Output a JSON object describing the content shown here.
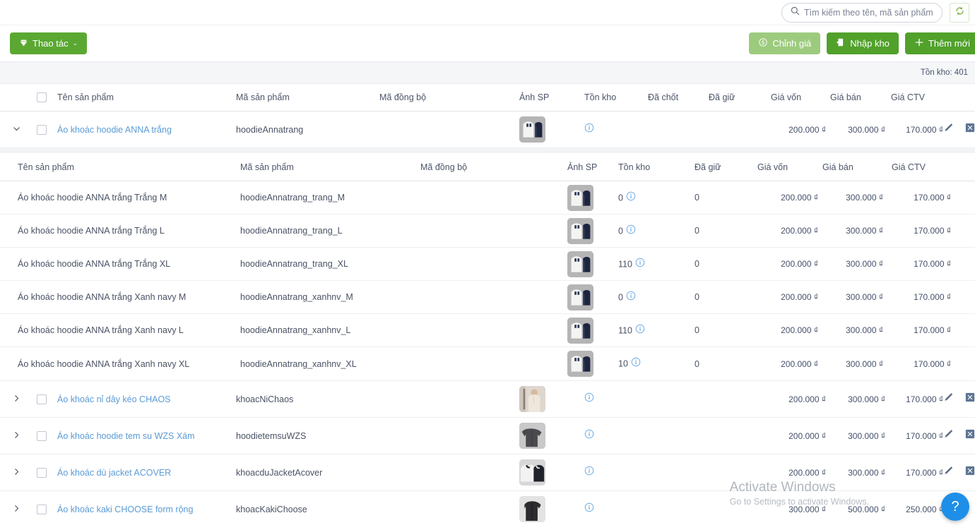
{
  "search": {
    "placeholder": "Tìm kiếm theo tên, mã sản phẩm",
    "value": "",
    "icon": "search-icon"
  },
  "refresh": {
    "icon": "refresh-icon",
    "label": ""
  },
  "toolbar": {
    "action_label": "Thao tác",
    "action_icon": "diamond-icon",
    "action_caret": "⌄",
    "adjust_price_label": "Chỉnh giá",
    "adjust_price_icon": "sync-price-icon",
    "import_stock_label": "Nhập kho",
    "import_stock_icon": "import-icon",
    "add_new_label": "Thêm mới",
    "add_new_icon": "plus-icon"
  },
  "summary": {
    "stock_total_label": "Tồn kho: 401"
  },
  "table": {
    "headers": {
      "name": "Tên sản phẩm",
      "code": "Mã sản phẩm",
      "sync": "Mã đồng bộ",
      "image": "Ảnh SP",
      "stock": "Tồn kho",
      "locked": "Đã chốt",
      "held": "Đã giữ",
      "cost": "Giá vốn",
      "sell": "Giá bán",
      "ctv": "Giá CTV"
    },
    "rows": [
      {
        "expanded": true,
        "expand_icon": "chevron-down-icon",
        "name": "Áo khoác hoodie ANNA trắng",
        "code": "hoodieAnnatrang",
        "sync": "",
        "thumb": "hoodie-white-navy",
        "stock": "",
        "locked": "",
        "held": "",
        "cost": "200.000 ₫",
        "sell": "300.000 ₫",
        "ctv": "170.000 ₫"
      },
      {
        "expanded": false,
        "expand_icon": "chevron-right-icon",
        "name": "Áo khoác nỉ dây kéo CHAOS",
        "code": "khoacNiChaos",
        "sync": "",
        "thumb": "model-beige",
        "stock": "",
        "locked": "",
        "held": "",
        "cost": "200.000 ₫",
        "sell": "300.000 ₫",
        "ctv": "170.000 ₫"
      },
      {
        "expanded": false,
        "expand_icon": "chevron-right-icon",
        "name": "Áo khoác hoodie tem su WZS Xám",
        "code": "hoodietemsuWZS",
        "sync": "",
        "thumb": "hoodie-grey",
        "stock": "",
        "locked": "",
        "held": "",
        "cost": "200.000 ₫",
        "sell": "300.000 ₫",
        "ctv": "170.000 ₫"
      },
      {
        "expanded": false,
        "expand_icon": "chevron-right-icon",
        "name": "Áo khoác dù jacket ACOVER",
        "code": "khoacduJacketAcover",
        "sync": "",
        "thumb": "jacket-black-white",
        "stock": "",
        "locked": "",
        "held": "",
        "cost": "200.000 ₫",
        "sell": "300.000 ₫",
        "ctv": "170.000 ₫"
      },
      {
        "expanded": false,
        "expand_icon": "chevron-right-icon",
        "name": "Áo khoác kaki CHOOSE form rộng",
        "code": "khoacKakiChoose",
        "sync": "",
        "thumb": "kaki-dark",
        "stock": "",
        "locked": "",
        "held": "",
        "cost": "300.000 ₫",
        "sell": "500.000 ₫",
        "ctv": "250.000 ₫"
      }
    ]
  },
  "subtable": {
    "headers": {
      "name": "Tên sản phẩm",
      "code": "Mã sản phẩm",
      "sync": "Mã đồng bộ",
      "image": "Ảnh SP",
      "stock": "Tồn kho",
      "held": "Đã giữ",
      "cost": "Giá vốn",
      "sell": "Giá bán",
      "ctv": "Giá CTV"
    },
    "rows": [
      {
        "name": "Áo khoác hoodie ANNA trắng Trắng M",
        "code": "hoodieAnnatrang_trang_M",
        "sync": "",
        "thumb": "hoodie-white-navy",
        "stock": "0",
        "held": "0",
        "cost": "200.000 ₫",
        "sell": "300.000 ₫",
        "ctv": "170.000 ₫"
      },
      {
        "name": "Áo khoác hoodie ANNA trắng Trắng L",
        "code": "hoodieAnnatrang_trang_L",
        "sync": "",
        "thumb": "hoodie-white-navy",
        "stock": "0",
        "held": "0",
        "cost": "200.000 ₫",
        "sell": "300.000 ₫",
        "ctv": "170.000 ₫"
      },
      {
        "name": "Áo khoác hoodie ANNA trắng Trắng XL",
        "code": "hoodieAnnatrang_trang_XL",
        "sync": "",
        "thumb": "hoodie-white-navy",
        "stock": "110",
        "held": "0",
        "cost": "200.000 ₫",
        "sell": "300.000 ₫",
        "ctv": "170.000 ₫"
      },
      {
        "name": "Áo khoác hoodie ANNA trắng Xanh navy M",
        "code": "hoodieAnnatrang_xanhnv_M",
        "sync": "",
        "thumb": "hoodie-white-navy",
        "stock": "0",
        "held": "0",
        "cost": "200.000 ₫",
        "sell": "300.000 ₫",
        "ctv": "170.000 ₫"
      },
      {
        "name": "Áo khoác hoodie ANNA trắng Xanh navy L",
        "code": "hoodieAnnatrang_xanhnv_L",
        "sync": "",
        "thumb": "hoodie-white-navy",
        "stock": "110",
        "held": "0",
        "cost": "200.000 ₫",
        "sell": "300.000 ₫",
        "ctv": "170.000 ₫"
      },
      {
        "name": "Áo khoác hoodie ANNA trắng Xanh navy XL",
        "code": "hoodieAnnatrang_xanhnv_XL",
        "sync": "",
        "thumb": "hoodie-white-navy",
        "stock": "10",
        "held": "0",
        "cost": "200.000 ₫",
        "sell": "300.000 ₫",
        "ctv": "170.000 ₫"
      }
    ]
  },
  "watermark": {
    "title": "Activate Windows",
    "subtitle": "Go to Settings to activate Windows."
  },
  "help": {
    "icon": "question-circle-icon",
    "label": "?"
  },
  "colors": {
    "primary_green": "#5aa832",
    "light_green": "#9dcb7e",
    "link_blue": "#5b9bd5",
    "info_blue": "#6aa9e0",
    "fab_blue": "#1e8fe8"
  }
}
